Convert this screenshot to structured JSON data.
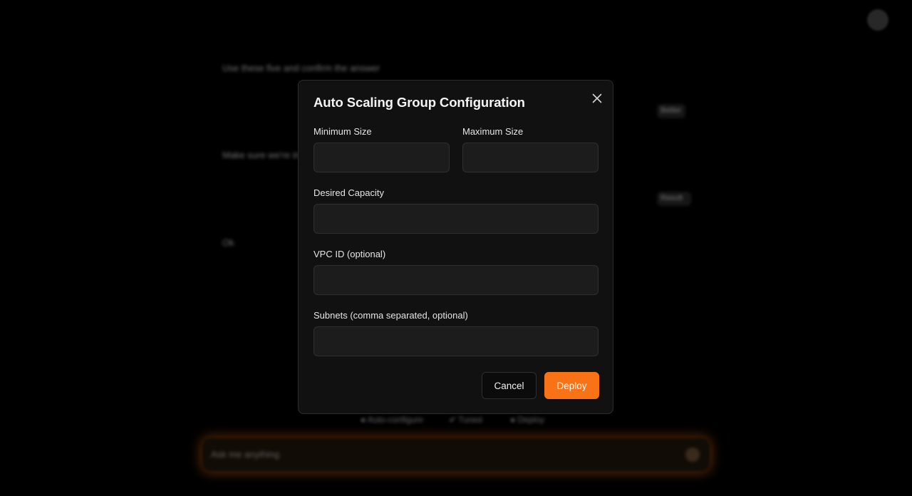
{
  "background": {
    "lines": [
      "Use these five and confirm the answer",
      "Make sure we're in range",
      "Ok"
    ],
    "side_labels": [
      "Better",
      "Result"
    ],
    "suggestions": [
      "Auto-configure",
      "Tuned",
      "Deploy"
    ],
    "chat_placeholder": "Ask me anything"
  },
  "modal": {
    "title": "Auto Scaling Group Configuration",
    "fields": {
      "min_size": {
        "label": "Minimum Size",
        "value": "",
        "placeholder": ""
      },
      "max_size": {
        "label": "Maximum Size",
        "value": "",
        "placeholder": ""
      },
      "desired_capacity": {
        "label": "Desired Capacity",
        "value": "",
        "placeholder": ""
      },
      "vpc_id": {
        "label": "VPC ID (optional)",
        "value": "",
        "placeholder": ""
      },
      "subnets": {
        "label": "Subnets (comma separated, optional)",
        "value": "",
        "placeholder": ""
      }
    },
    "buttons": {
      "cancel": "Cancel",
      "deploy": "Deploy"
    }
  },
  "colors": {
    "accent": "#f97316",
    "modal_background": "#111111",
    "input_background": "#1c1c1c",
    "page_background": "#000000"
  },
  "icons": {
    "close": "close-icon",
    "avatar": "avatar"
  }
}
